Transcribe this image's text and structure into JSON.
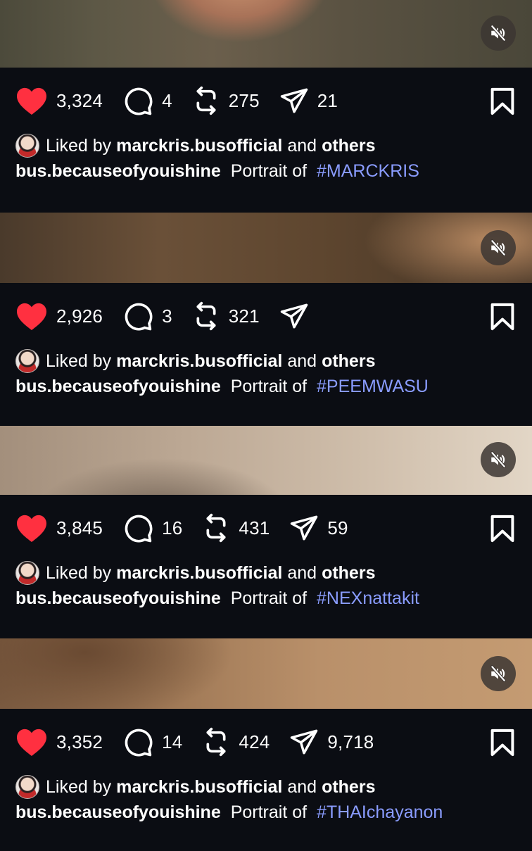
{
  "posts": [
    {
      "likes": "3,324",
      "comments": "4",
      "reposts": "275",
      "shares": "21",
      "liked_prefix": "Liked by",
      "liked_user": "marckris.busofficial",
      "liked_and": "and",
      "liked_others": "others",
      "author": "bus.becauseofyouishine",
      "caption_text": "Portrait of",
      "hashtag": "#MARCKRIS"
    },
    {
      "likes": "2,926",
      "comments": "3",
      "reposts": "321",
      "shares": "",
      "liked_prefix": "Liked by",
      "liked_user": "marckris.busofficial",
      "liked_and": "and",
      "liked_others": "others",
      "author": "bus.becauseofyouishine",
      "caption_text": "Portrait of",
      "hashtag": "#PEEMWASU"
    },
    {
      "likes": "3,845",
      "comments": "16",
      "reposts": "431",
      "shares": "59",
      "liked_prefix": "Liked by",
      "liked_user": "marckris.busofficial",
      "liked_and": "and",
      "liked_others": "others",
      "author": "bus.becauseofyouishine",
      "caption_text": "Portrait of",
      "hashtag": "#NEXnattakit"
    },
    {
      "likes": "3,352",
      "comments": "14",
      "reposts": "424",
      "shares": "9,718",
      "liked_prefix": "Liked by",
      "liked_user": "marckris.busofficial",
      "liked_and": "and",
      "liked_others": "others",
      "author": "bus.becauseofyouishine",
      "caption_text": "Portrait of",
      "hashtag": "#THAIchayanon"
    }
  ],
  "icons": {
    "like": "heart-icon",
    "comment": "comment-icon",
    "repost": "repost-icon",
    "share": "send-icon",
    "save": "bookmark-icon",
    "mute": "muted-speaker-icon"
  },
  "colors": {
    "background": "#0b0d13",
    "like_red": "#ff3040",
    "hashtag_blue": "#8a9cff",
    "text": "#ffffff"
  }
}
